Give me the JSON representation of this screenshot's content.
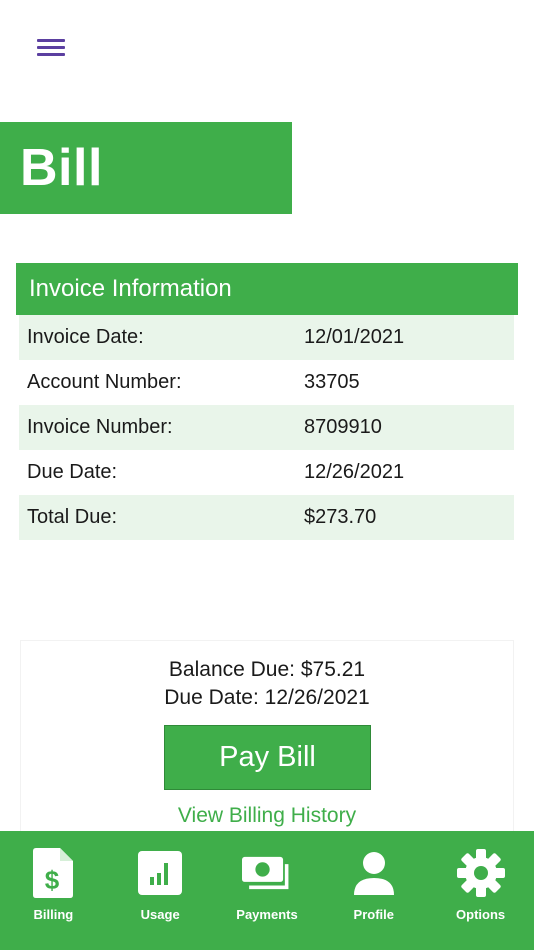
{
  "header": {
    "title": "Bill"
  },
  "invoice": {
    "heading": "Invoice Information",
    "rows": [
      {
        "label": "Invoice Date:",
        "value": "12/01/2021"
      },
      {
        "label": "Account Number:",
        "value": "33705"
      },
      {
        "label": "Invoice Number:",
        "value": "8709910"
      },
      {
        "label": "Due Date:",
        "value": "12/26/2021"
      },
      {
        "label": "Total Due:",
        "value": "$273.70"
      }
    ]
  },
  "summary": {
    "balance_due": "Balance Due: $75.21",
    "due_date": "Due Date: 12/26/2021",
    "pay_button": "Pay Bill",
    "history_link": "View Billing History"
  },
  "tabbar": {
    "items": [
      {
        "label": "Billing",
        "icon": "bill-document-icon"
      },
      {
        "label": "Usage",
        "icon": "bar-chart-icon"
      },
      {
        "label": "Payments",
        "icon": "cash-icon"
      },
      {
        "label": "Profile",
        "icon": "person-icon"
      },
      {
        "label": "Options",
        "icon": "gear-icon"
      }
    ]
  },
  "colors": {
    "accent": "#3fae4a",
    "row_alt": "#e9f5ea",
    "menu": "#5b3fa0"
  }
}
